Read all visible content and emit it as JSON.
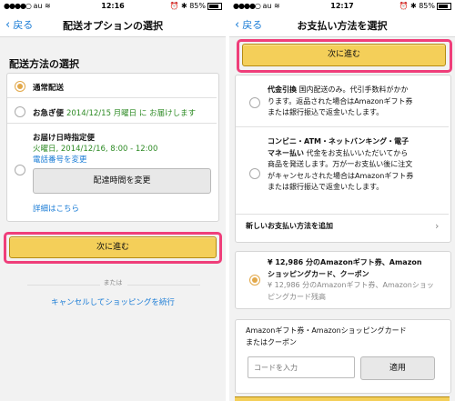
{
  "left": {
    "status": {
      "carrier": "au",
      "time": "12:16",
      "battery": "85%"
    },
    "nav": {
      "back": "戻る",
      "title": "配送オプションの選択"
    },
    "section_title": "配送方法の選択",
    "options": [
      {
        "label": "通常配送",
        "selected": true
      },
      {
        "label": "お急ぎ便",
        "extra": "2014/12/15 月曜日 に お届けします",
        "selected": false
      },
      {
        "label": "お届け日時指定便",
        "line2": "火曜日, 2014/12/16, 8:00 - 12:00",
        "line3": "電話番号を変更",
        "selected": false
      }
    ],
    "change_time_button": "配達時間を変更",
    "details_link": "詳細はこちら",
    "next_button": "次に進む",
    "or_text": "または",
    "cancel_link": "キャンセルしてショッピングを続行"
  },
  "right": {
    "status": {
      "carrier": "au",
      "time": "12:17",
      "battery": "85%"
    },
    "nav": {
      "back": "戻る",
      "title": "お支払い方法を選択"
    },
    "next_button": "次に進む",
    "payments": [
      {
        "title": "代金引換",
        "lines": [
          " 国内配送のみ。代引手数料がかか",
          "ります。返品された場合はAmazonギフト券",
          "または銀行振込で返金いたします。"
        ]
      },
      {
        "title": "コンビニ・ATM・ネットバンキング・電子",
        "lines": [
          "マネー払い",
          " 代金をお支払いいただいてから",
          "商品を発送します。万が一お支払い後に注文",
          "がキャンセルされた場合はAmazonギフト券",
          "または銀行振込で返金いたします。"
        ]
      }
    ],
    "add_payment": "新しいお支払い方法を追加",
    "giftcard_option": {
      "title1": "¥ 12,986 分のAmazonギフト券、Amazon",
      "title2": "ショッピングカード、クーポン",
      "sub1": "¥ 12,986 分のAmazonギフト券、Amazonショッ",
      "sub2": "ピングカード残高"
    },
    "gift_box": {
      "label1": "Amazonギフト券・Amazonショッピングカード",
      "label2": "またはクーポン",
      "placeholder": "コードを入力",
      "apply": "適用"
    }
  }
}
